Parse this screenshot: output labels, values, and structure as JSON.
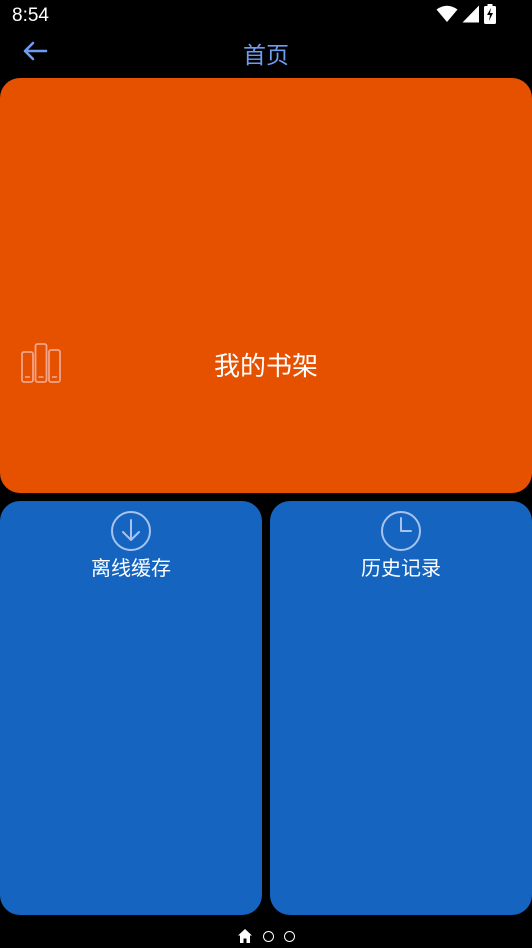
{
  "status_bar": {
    "time": "8:54",
    "icons": [
      "wifi-icon",
      "signal-icon",
      "battery-charging-icon"
    ]
  },
  "app_bar": {
    "back_icon": "arrow-left-icon",
    "title": "首页",
    "title_color": "#6f9cf2"
  },
  "tiles": {
    "shelf": {
      "label": "我的书架",
      "icon": "bookshelf-icon",
      "color": "#e65100"
    },
    "offline": {
      "label": "离线缓存",
      "icon": "download-icon",
      "color": "#1565c0"
    },
    "history": {
      "label": "历史记录",
      "icon": "clock-icon",
      "color": "#1565c0"
    }
  },
  "page_indicator": {
    "items": [
      "home-icon",
      "dot",
      "dot"
    ],
    "current": 0
  }
}
